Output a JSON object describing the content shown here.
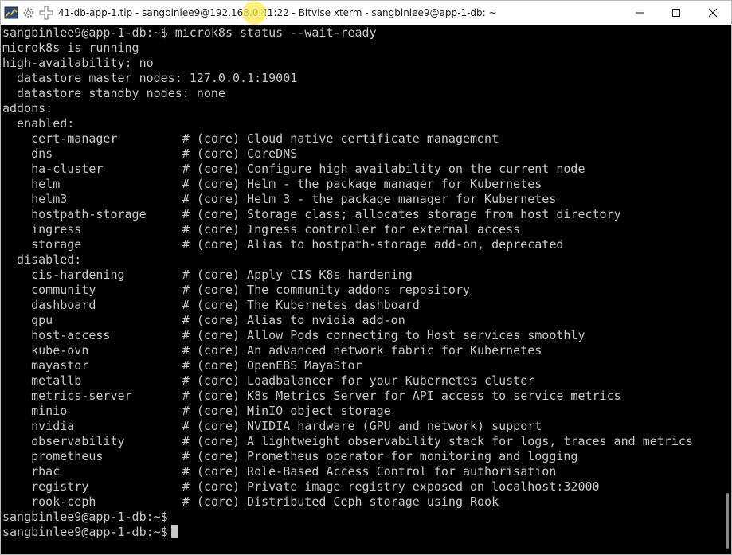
{
  "window": {
    "title": "41-db-app-1.tlp - sangbinlee9@192.168.0.41:22 - Bitvise xterm - sangbinlee9@app-1-db: ~",
    "icons": [
      "app-chart-icon",
      "gear-icon",
      "move-cross-icon"
    ],
    "controls": [
      "minimize-icon",
      "maximize-icon",
      "close-icon"
    ]
  },
  "terminal": {
    "lines": [
      "sangbinlee9@app-1-db:~$ microk8s status --wait-ready",
      "microk8s is running",
      "high-availability: no",
      "  datastore master nodes: 127.0.0.1:19001",
      "  datastore standby nodes: none",
      "addons:",
      "  enabled:",
      "    cert-manager         # (core) Cloud native certificate management",
      "    dns                  # (core) CoreDNS",
      "    ha-cluster           # (core) Configure high availability on the current node",
      "    helm                 # (core) Helm - the package manager for Kubernetes",
      "    helm3                # (core) Helm 3 - the package manager for Kubernetes",
      "    hostpath-storage     # (core) Storage class; allocates storage from host directory",
      "    ingress              # (core) Ingress controller for external access",
      "    storage              # (core) Alias to hostpath-storage add-on, deprecated",
      "  disabled:",
      "    cis-hardening        # (core) Apply CIS K8s hardening",
      "    community            # (core) The community addons repository",
      "    dashboard            # (core) The Kubernetes dashboard",
      "    gpu                  # (core) Alias to nvidia add-on",
      "    host-access          # (core) Allow Pods connecting to Host services smoothly",
      "    kube-ovn             # (core) An advanced network fabric for Kubernetes",
      "    mayastor             # (core) OpenEBS MayaStor",
      "    metallb              # (core) Loadbalancer for your Kubernetes cluster",
      "    metrics-server       # (core) K8s Metrics Server for API access to service metrics",
      "    minio                # (core) MinIO object storage",
      "    nvidia               # (core) NVIDIA hardware (GPU and network) support",
      "    observability        # (core) A lightweight observability stack for logs, traces and metrics",
      "    prometheus           # (core) Prometheus operator for monitoring and logging",
      "    rbac                 # (core) Role-Based Access Control for authorisation",
      "    registry             # (core) Private image registry exposed on localhost:32000",
      "    rook-ceph            # (core) Distributed Ceph storage using Rook",
      "sangbinlee9@app-1-db:~$"
    ],
    "prompt": "sangbinlee9@app-1-db:~$"
  }
}
